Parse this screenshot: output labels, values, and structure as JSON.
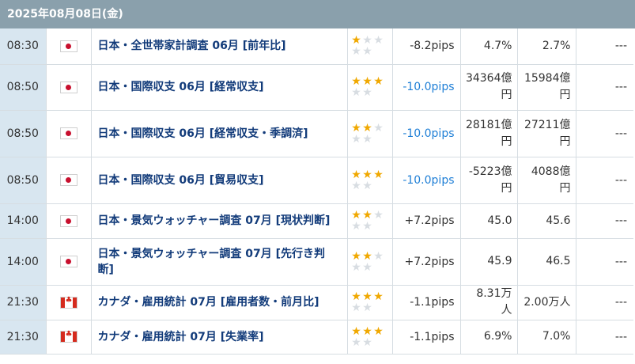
{
  "header": {
    "date": "2025年08月08日(金)"
  },
  "colors": {
    "header_bg": "#8aa0ac",
    "time_bg": "#d8e6f0",
    "star_on": "#f0a800",
    "star_off": "#d8dde2",
    "title": "#123b7a",
    "pips_negative_blue": "#1f7fd6"
  },
  "rows": [
    {
      "time": "08:30",
      "flag": "jp-flag-icon",
      "title": "日本・全世帯家計調査 06月 [前年比]",
      "stars": 1,
      "pips": "-8.2pips",
      "pips_blue": false,
      "prev": "4.7%",
      "forecast": "2.7%",
      "actual": "---"
    },
    {
      "time": "08:50",
      "flag": "jp-flag-icon",
      "title": "日本・国際収支 06月 [経常収支]",
      "stars": 3,
      "pips": "-10.0pips",
      "pips_blue": true,
      "prev": "34364億円",
      "forecast": "15984億円",
      "actual": "---"
    },
    {
      "time": "08:50",
      "flag": "jp-flag-icon",
      "title": "日本・国際収支 06月 [経常収支・季調済]",
      "stars": 2,
      "pips": "-10.0pips",
      "pips_blue": true,
      "prev": "28181億円",
      "forecast": "27211億円",
      "actual": "---"
    },
    {
      "time": "08:50",
      "flag": "jp-flag-icon",
      "title": "日本・国際収支 06月 [貿易収支]",
      "stars": 3,
      "pips": "-10.0pips",
      "pips_blue": true,
      "prev": "-5223億円",
      "forecast": "4088億円",
      "actual": "---"
    },
    {
      "time": "14:00",
      "flag": "jp-flag-icon",
      "title": "日本・景気ウォッチャー調査 07月 [現状判断]",
      "stars": 2,
      "pips": "+7.2pips",
      "pips_blue": false,
      "prev": "45.0",
      "forecast": "45.6",
      "actual": "---"
    },
    {
      "time": "14:00",
      "flag": "jp-flag-icon",
      "title": "日本・景気ウォッチャー調査 07月 [先行き判断]",
      "stars": 2,
      "pips": "+7.2pips",
      "pips_blue": false,
      "prev": "45.9",
      "forecast": "46.5",
      "actual": "---"
    },
    {
      "time": "21:30",
      "flag": "ca-flag-icon",
      "title": "カナダ・雇用統計 07月 [雇用者数・前月比]",
      "stars": 3,
      "pips": "-1.1pips",
      "pips_blue": false,
      "prev": "8.31万人",
      "forecast": "2.00万人",
      "actual": "---"
    },
    {
      "time": "21:30",
      "flag": "ca-flag-icon",
      "title": "カナダ・雇用統計 07月 [失業率]",
      "stars": 3,
      "pips": "-1.1pips",
      "pips_blue": false,
      "prev": "6.9%",
      "forecast": "7.0%",
      "actual": "---"
    }
  ]
}
